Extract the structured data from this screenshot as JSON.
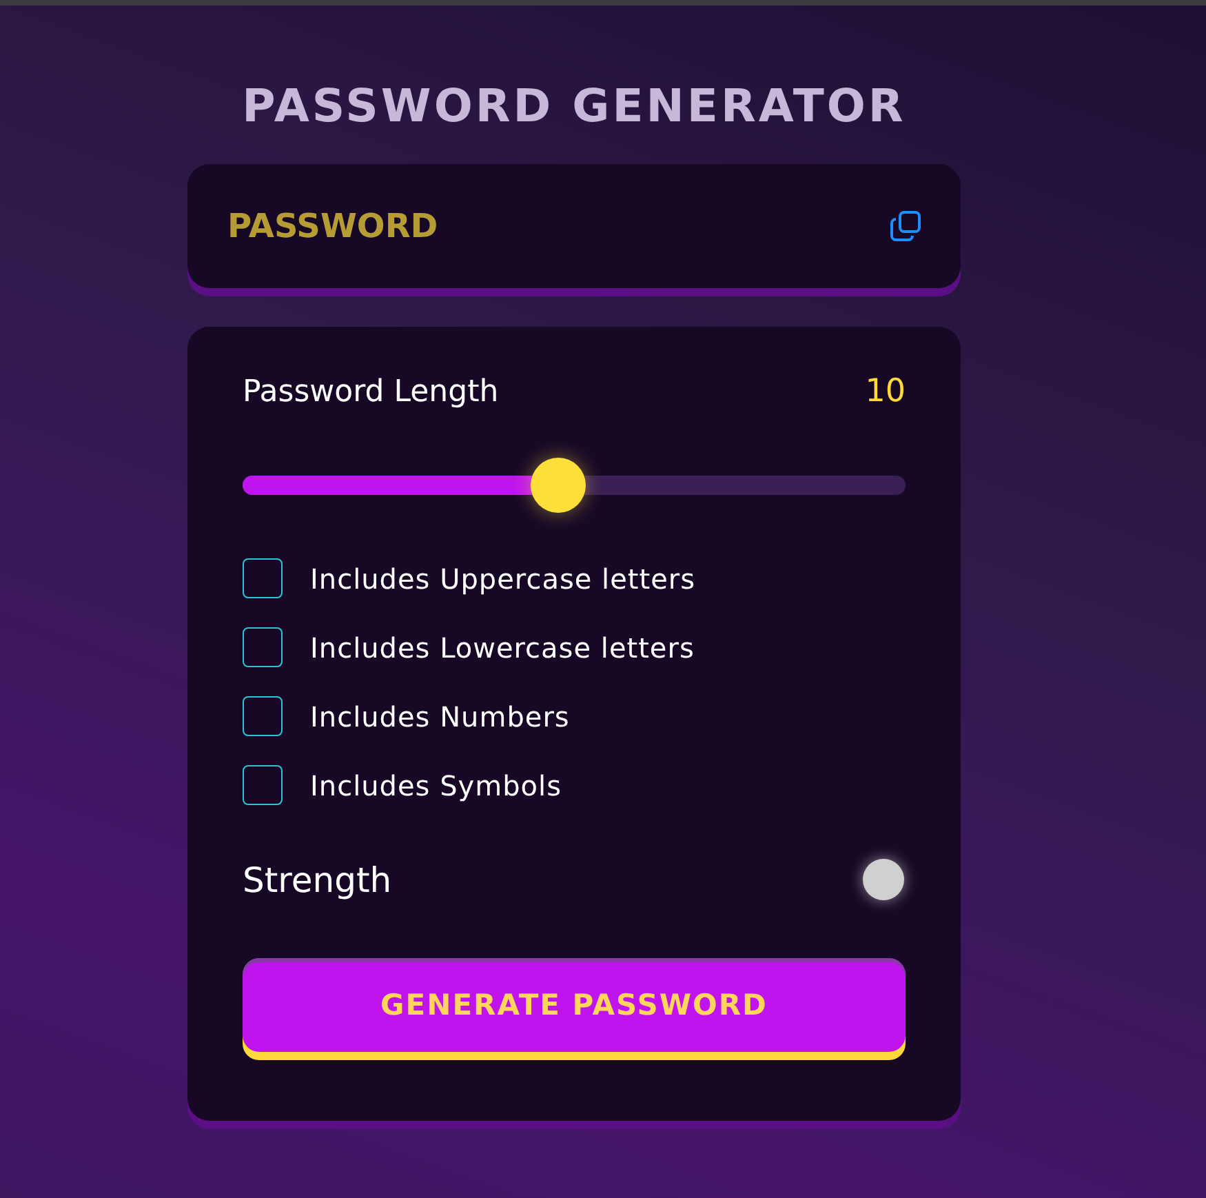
{
  "title": "PASSWORD GENERATOR",
  "password_field": {
    "placeholder": "PASSWORD"
  },
  "length": {
    "label": "Password Length",
    "value": "10",
    "level": 0.476
  },
  "options": [
    {
      "label": "Includes Uppercase letters",
      "checked": false
    },
    {
      "label": "Includes Lowercase letters",
      "checked": false
    },
    {
      "label": "Includes Numbers",
      "checked": false
    },
    {
      "label": "Includes Symbols",
      "checked": false
    }
  ],
  "strength": {
    "label": "Strength"
  },
  "generate_button": "GENERATE PASSWORD"
}
